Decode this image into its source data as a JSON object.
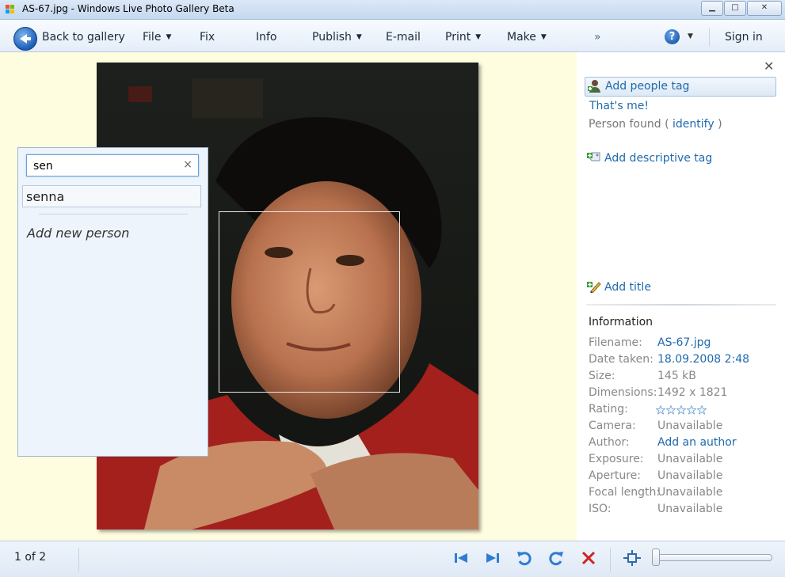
{
  "window": {
    "title": "AS-67.jpg - Windows Live Photo Gallery Beta",
    "minimize": "▁",
    "maximize": "□",
    "close": "✕"
  },
  "menubar": {
    "back": "Back to gallery",
    "file": "File",
    "fix": "Fix",
    "info": "Info",
    "publish": "Publish",
    "email": "E-mail",
    "print": "Print",
    "make": "Make",
    "overflow": "»",
    "help": "?",
    "signin": "Sign in"
  },
  "tag_popup": {
    "input_value": "sen",
    "clear": "×",
    "suggestion": "senna",
    "add_new": "Add new person"
  },
  "pane": {
    "close": "✕",
    "add_people_tag": "Add people tag",
    "thats_me": "That's me!",
    "person_found_prefix": "Person found (",
    "identify": "identify",
    "person_found_suffix": ")",
    "add_descriptive_tag": "Add descriptive tag",
    "add_title": "Add title",
    "information_heading": "Information",
    "info": [
      {
        "key": "Filename:",
        "value": "AS-67.jpg"
      },
      {
        "key": "Date taken:",
        "value": "18.09.2008  2:48"
      },
      {
        "key": "Size:",
        "value": "145 kB"
      },
      {
        "key": "Dimensions:",
        "value": "1492 x 1821"
      },
      {
        "key": "Rating:",
        "value": ""
      },
      {
        "key": "Camera:",
        "value": "Unavailable"
      },
      {
        "key": "Author:",
        "value": "Add an author"
      },
      {
        "key": "Exposure:",
        "value": "Unavailable"
      },
      {
        "key": "Aperture:",
        "value": "Unavailable"
      },
      {
        "key": "Focal length:",
        "value": "Unavailable"
      },
      {
        "key": "ISO:",
        "value": "Unavailable"
      }
    ],
    "rating_stars": 0,
    "rating_max": 5
  },
  "statusbar": {
    "page_count": "1 of 2",
    "zoom_level": 0
  },
  "colors": {
    "link": "#1f6aad",
    "image_background": "#fffde0",
    "delete_red": "#d32020",
    "nav_blue": "#2f7dd1"
  }
}
